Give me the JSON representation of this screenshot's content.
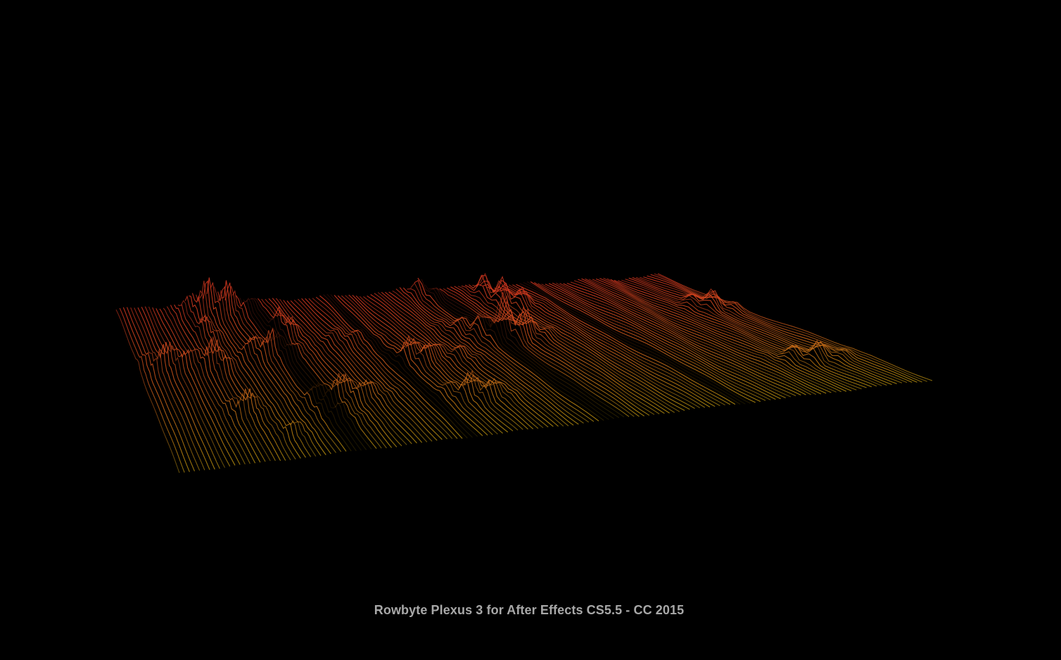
{
  "caption": {
    "text": "Rowbyte Plexus 3 for After Effects CS5.5 - CC 2015"
  },
  "scene": {
    "description_icon": "plexus-wave-mesh-icon",
    "colors": {
      "background": "#000000",
      "far_edge": "#c8321e",
      "near_edge": "#b48c10",
      "caption": "#a8a8a8"
    }
  }
}
